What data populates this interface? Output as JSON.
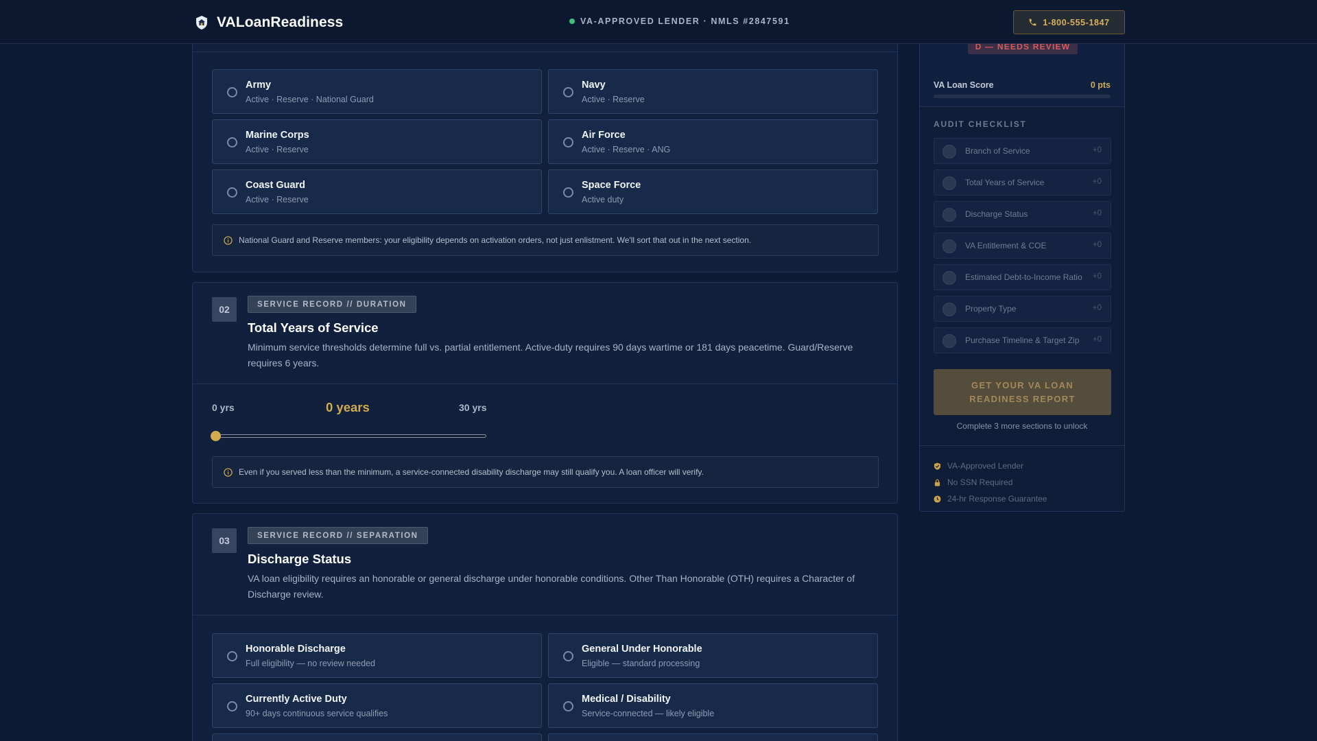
{
  "header": {
    "brand_name": "VALoanReadiness",
    "lender_status": "VA-APPROVED LENDER · NMLS #2847591",
    "phone": "1-800-555-1847"
  },
  "colors": {
    "background": "#0c1a33",
    "card": "#10203d",
    "accent_gold": "#d4aa4e",
    "status_green": "#3fbf7f",
    "alert_red": "#d85a5a"
  },
  "branch": {
    "options": [
      {
        "title": "Army",
        "subtitle": "Active · Reserve · National Guard"
      },
      {
        "title": "Navy",
        "subtitle": "Active · Reserve"
      },
      {
        "title": "Marine Corps",
        "subtitle": "Active · Reserve"
      },
      {
        "title": "Air Force",
        "subtitle": "Active · Reserve · ANG"
      },
      {
        "title": "Coast Guard",
        "subtitle": "Active · Reserve"
      },
      {
        "title": "Space Force",
        "subtitle": "Active duty"
      }
    ],
    "note": "National Guard and Reserve members: your eligibility depends on activation orders, not just enlistment. We'll sort that out in the next section."
  },
  "service_years": {
    "number": "02",
    "tag": "SERVICE RECORD // DURATION",
    "title": "Total Years of Service",
    "description": "Minimum service thresholds determine full vs. partial entitlement. Active-duty requires 90 days wartime or 181 days peacetime. Guard/Reserve requires 6 years.",
    "slider": {
      "min_label": "0 yrs",
      "max_label": "30 yrs",
      "value_label": "0 years",
      "min": 0,
      "max": 30,
      "value": 0
    },
    "note": "Even if you served less than the minimum, a service-connected disability discharge may still qualify you. A loan officer will verify."
  },
  "discharge": {
    "number": "03",
    "tag": "SERVICE RECORD // SEPARATION",
    "title": "Discharge Status",
    "description": "VA loan eligibility requires an honorable or general discharge under honorable conditions. Other Than Honorable (OTH) requires a Character of Discharge review.",
    "options": [
      {
        "title": "Honorable Discharge",
        "subtitle": "Full eligibility — no review needed"
      },
      {
        "title": "General Under Honorable",
        "subtitle": "Eligible — standard processing"
      },
      {
        "title": "Currently Active Duty",
        "subtitle": "90+ days continuous service qualifies"
      },
      {
        "title": "Medical / Disability",
        "subtitle": "Service-connected — likely eligible"
      }
    ]
  },
  "sidebar": {
    "grade": "D — NEEDS REVIEW",
    "score_label": "VA Loan Score",
    "score_value": "0 pts",
    "score_fraction": 0,
    "checklist_title": "AUDIT CHECKLIST",
    "checklist": [
      {
        "label": "Branch of Service",
        "points": "+0"
      },
      {
        "label": "Total Years of Service",
        "points": "+0"
      },
      {
        "label": "Discharge Status",
        "points": "+0"
      },
      {
        "label": "VA Entitlement & COE",
        "points": "+0"
      },
      {
        "label": "Estimated Debt-to-Income Ratio",
        "points": "+0"
      },
      {
        "label": "Property Type",
        "points": "+0"
      },
      {
        "label": "Purchase Timeline & Target Zip",
        "points": "+0"
      }
    ],
    "report_button": "GET YOUR VA LOAN READINESS REPORT",
    "unlock_note": "Complete 3 more sections to unlock",
    "trust": [
      {
        "label": "VA-Approved Lender",
        "icon": "shield-check-icon"
      },
      {
        "label": "No SSN Required",
        "icon": "lock-icon"
      },
      {
        "label": "24-hr Response Guarantee",
        "icon": "clock-icon"
      }
    ]
  }
}
